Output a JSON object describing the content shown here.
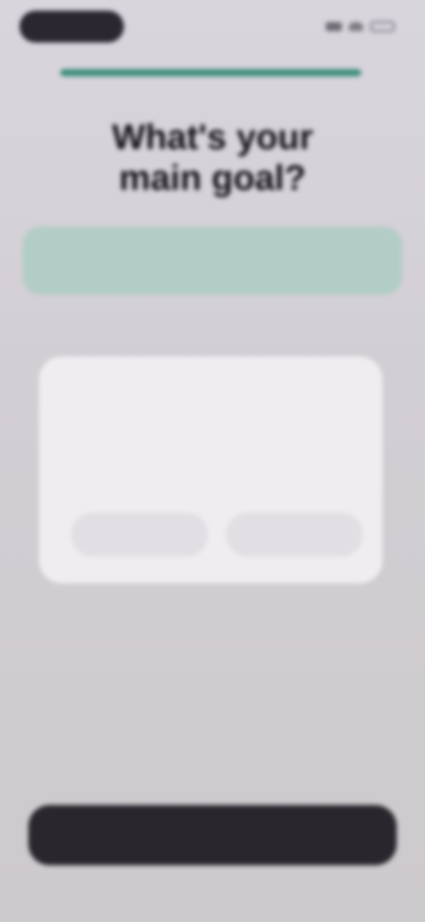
{
  "status_bar": {
    "signal_icon": "signal-icon",
    "wifi_icon": "wifi-icon",
    "battery_icon": "battery-icon"
  },
  "progress": {
    "value": 1.0
  },
  "header": {
    "title_line1": "What's your",
    "title_line2": "main goal?"
  },
  "selected_option": {
    "label": ""
  },
  "section": {
    "label": ""
  },
  "card": {
    "title": "",
    "body": "",
    "button_left": "",
    "button_right": ""
  },
  "link": {
    "label": ""
  },
  "cta": {
    "label": ""
  },
  "colors": {
    "accent": "#3a8c78",
    "selected_bg": "#b2cdc6",
    "cta_bg": "#29262d"
  }
}
